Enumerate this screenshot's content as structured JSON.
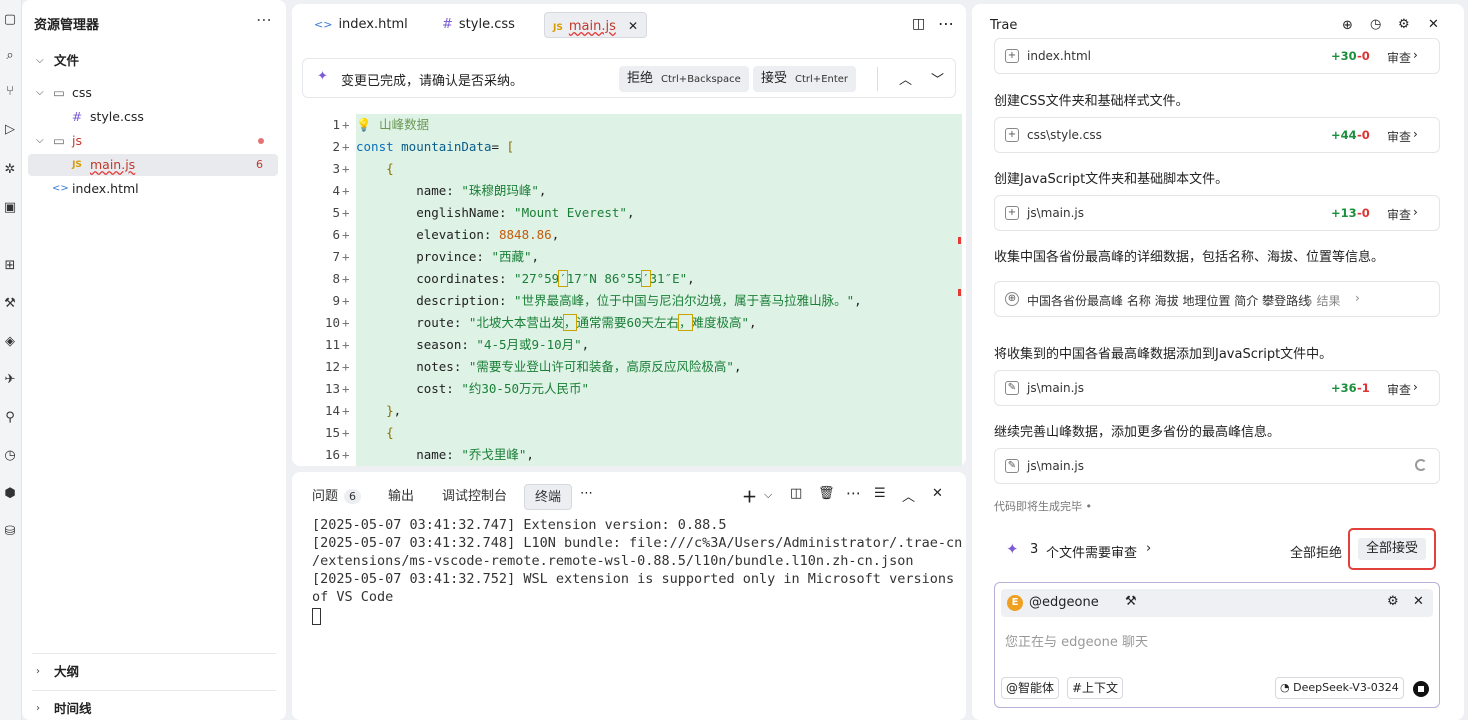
{
  "explorer": {
    "title": "资源管理器",
    "section": "文件",
    "tree": [
      {
        "label": "css",
        "kind": "folder"
      },
      {
        "label": "style.css",
        "kind": "css"
      },
      {
        "label": "js",
        "kind": "folder"
      },
      {
        "label": "main.js",
        "kind": "js",
        "badge": "6"
      },
      {
        "label": "index.html",
        "kind": "html"
      }
    ],
    "outline": "大纲",
    "timeline": "时间线"
  },
  "editor": {
    "tabs": [
      {
        "label": "index.html",
        "icon": "<>"
      },
      {
        "label": "style.css",
        "icon": "#"
      },
      {
        "label": "main.js",
        "icon": "JS"
      }
    ],
    "banner": {
      "text": "变更已完成，请确认是否采纳。",
      "reject": "拒绝",
      "reject_kb": "Ctrl+Backspace",
      "accept": "接受",
      "accept_kb": "Ctrl+Enter"
    },
    "code": [
      {
        "n": "1",
        "segs": [
          [
            "cm",
            "💡 山峰数据"
          ]
        ]
      },
      {
        "n": "2",
        "segs": [
          [
            "kw",
            "const "
          ],
          [
            "vr",
            "mountainData"
          ],
          [
            "",
            "= "
          ],
          [
            "br",
            "["
          ]
        ]
      },
      {
        "n": "3",
        "segs": [
          [
            "",
            "    "
          ],
          [
            "br",
            "{"
          ]
        ]
      },
      {
        "n": "4",
        "segs": [
          [
            "",
            "        name: "
          ],
          [
            "str",
            "\"珠穆朗玛峰\""
          ],
          [
            "",
            ","
          ]
        ]
      },
      {
        "n": "5",
        "segs": [
          [
            "",
            "        englishName: "
          ],
          [
            "str",
            "\"Mount Everest\""
          ],
          [
            "",
            ","
          ]
        ]
      },
      {
        "n": "6",
        "segs": [
          [
            "",
            "        elevation: "
          ],
          [
            "num",
            "8848.86"
          ],
          [
            "",
            ","
          ]
        ]
      },
      {
        "n": "7",
        "segs": [
          [
            "",
            "        province: "
          ],
          [
            "str",
            "\"西藏\""
          ],
          [
            "",
            ","
          ]
        ]
      },
      {
        "n": "8",
        "segs": [
          [
            "",
            "        coordinates: "
          ],
          [
            "str",
            "\"27°59"
          ],
          [
            "strbx",
            "′"
          ],
          [
            "str",
            "17″N 86°55"
          ],
          [
            "strbx",
            "′"
          ],
          [
            "str",
            "31″E\""
          ],
          [
            "",
            ","
          ]
        ]
      },
      {
        "n": "9",
        "segs": [
          [
            "",
            "        description: "
          ],
          [
            "str",
            "\"世界最高峰，位于中国与尼泊尔边境，属于喜马拉雅山脉。\""
          ],
          [
            "",
            ","
          ]
        ]
      },
      {
        "n": "10",
        "segs": [
          [
            "",
            "        route: "
          ],
          [
            "str",
            "\"北坡大本营出发"
          ],
          [
            "strbx",
            "，"
          ],
          [
            "str",
            "通常需要60天左右"
          ],
          [
            "strbx",
            "，"
          ],
          [
            "str",
            "难度极高\""
          ],
          [
            "",
            ","
          ]
        ]
      },
      {
        "n": "11",
        "segs": [
          [
            "",
            "        season: "
          ],
          [
            "str",
            "\"4-5月或9-10月\""
          ],
          [
            "",
            ","
          ]
        ]
      },
      {
        "n": "12",
        "segs": [
          [
            "",
            "        notes: "
          ],
          [
            "str",
            "\"需要专业登山许可和装备，高原反应风险极高\""
          ],
          [
            "",
            ","
          ]
        ]
      },
      {
        "n": "13",
        "segs": [
          [
            "",
            "        cost: "
          ],
          [
            "str",
            "\"约30-50万元人民币\""
          ]
        ]
      },
      {
        "n": "14",
        "segs": [
          [
            "",
            "    "
          ],
          [
            "br",
            "}"
          ],
          [
            "",
            ","
          ]
        ]
      },
      {
        "n": "15",
        "segs": [
          [
            "",
            "    "
          ],
          [
            "br",
            "{"
          ]
        ]
      },
      {
        "n": "16",
        "segs": [
          [
            "",
            "        name: "
          ],
          [
            "str",
            "\"乔戈里峰\""
          ],
          [
            "",
            ","
          ]
        ]
      }
    ]
  },
  "panel": {
    "tabs": [
      "问题",
      "输出",
      "调试控制台",
      "终端"
    ],
    "problems_count": "6",
    "terminal": [
      "[2025-05-07 03:41:32.747] Extension version: 0.88.5",
      "[2025-05-07 03:41:32.748] L10N bundle: file:///c%3A/Users/Administrator/.trae-cn",
      "/extensions/ms-vscode-remote.remote-wsl-0.88.5/l10n/bundle.l10n.zh-cn.json",
      "[2025-05-07 03:41:32.752] WSL extension is supported only in Microsoft versions",
      "of VS Code"
    ]
  },
  "chat": {
    "title": "Trae",
    "cards": [
      {
        "file": "index.html",
        "add": "+30",
        "del": "-0",
        "review": "审查"
      },
      {
        "file": "css\\style.css",
        "add": "+44",
        "del": "-0",
        "review": "审查"
      },
      {
        "file": "js\\main.js",
        "add": "+13",
        "del": "-0",
        "review": "审查"
      },
      {
        "file": "js\\main.js",
        "add": "+36",
        "del": "-1",
        "review": "审查"
      },
      {
        "file": "js\\main.js"
      }
    ],
    "messages": [
      "创建CSS文件夹和基础样式文件。",
      "创建JavaScript文件夹和基础脚本文件。",
      "收集中国各省份最高峰的详细数据，包括名称、海拔、位置等信息。",
      "将收集到的中国各省最高峰数据添加到JavaScript文件中。",
      "继续完善山峰数据，添加更多省份的最高峰信息。"
    ],
    "search": {
      "query": "中国各省份最高峰 名称 海拔 地理位置 简介 攀登路线",
      "results": "5 结果"
    },
    "status": "代码即将生成完毕 •",
    "review_bar": {
      "count": "3",
      "text": "个文件需要审查",
      "reject_all": "全部拒绝",
      "accept_all": "全部接受"
    },
    "input": {
      "agent": "@edgeone",
      "agent_initial": "E",
      "placeholder": "您正在与 edgeone 聊天",
      "agent_btn": "@智能体",
      "context_btn": "#上下文",
      "model": "DeepSeek-V3-0324"
    }
  }
}
